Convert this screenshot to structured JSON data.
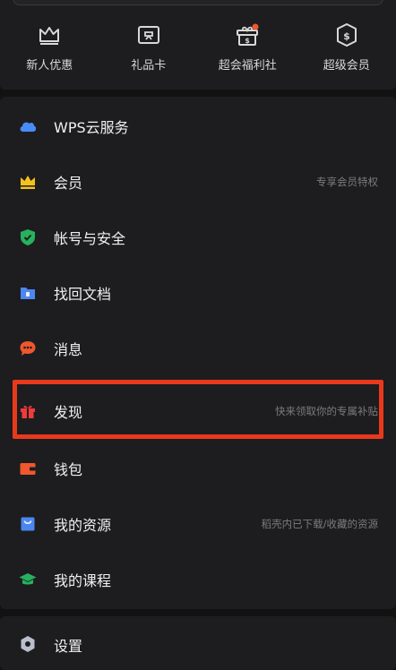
{
  "quick_actions": [
    {
      "label": "新人优惠",
      "icon": "crown-icon"
    },
    {
      "label": "礼品卡",
      "icon": "gift-card-icon"
    },
    {
      "label": "超会福利社",
      "icon": "gift-box-icon"
    },
    {
      "label": "超级会员",
      "icon": "dollar-shield-icon"
    }
  ],
  "menu": [
    {
      "label": "WPS云服务",
      "hint": "",
      "icon": "cloud-icon",
      "color": "#4a8cf7"
    },
    {
      "label": "会员",
      "hint": "专享会员特权",
      "icon": "crown-icon",
      "color": "#f4c21b"
    },
    {
      "label": "帐号与安全",
      "hint": "",
      "icon": "shield-icon",
      "color": "#27b15e"
    },
    {
      "label": "找回文档",
      "hint": "",
      "icon": "folder-icon",
      "color": "#4c87f0"
    },
    {
      "label": "消息",
      "hint": "",
      "icon": "chat-icon",
      "color": "#f0572d"
    },
    {
      "label": "发现",
      "hint": "快来领取你的专属补贴",
      "icon": "gift-icon",
      "color": "#ef3b3b"
    },
    {
      "label": "钱包",
      "hint": "",
      "icon": "wallet-icon",
      "color": "#f0572d"
    },
    {
      "label": "我的资源",
      "hint": "稻壳内已下载/收藏的资源",
      "icon": "bag-icon",
      "color": "#4c87f0"
    },
    {
      "label": "我的课程",
      "hint": "",
      "icon": "graduation-cap-icon",
      "color": "#27b15e"
    }
  ],
  "bottom": {
    "label": "设置",
    "icon": "settings-icon"
  },
  "colors": {
    "background": "#121212",
    "card": "#1d1d1f",
    "highlight": "#e8391c",
    "badge": "#f0572d"
  }
}
